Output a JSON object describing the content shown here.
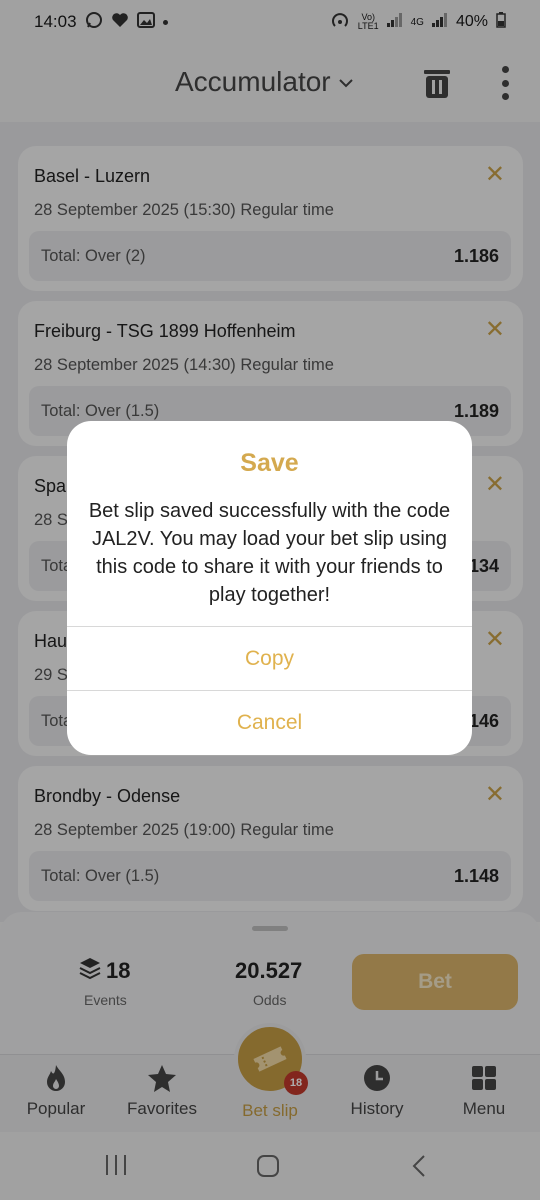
{
  "status": {
    "time": "14:03",
    "battery": "40%",
    "network": "4G"
  },
  "header": {
    "title": "Accumulator"
  },
  "bets": [
    {
      "match": "Basel - Luzern",
      "date": "28 September 2025 (15:30) Regular time",
      "pick": "Total: Over (2)",
      "odd": "1.186"
    },
    {
      "match": "Freiburg - TSG 1899 Hoffenheim",
      "date": "28 September 2025 (14:30) Regular time",
      "pick": "Total: Over (1.5)",
      "odd": "1.189"
    },
    {
      "match": "Spa",
      "date": "28 S",
      "pick": "Tota",
      "odd": "134"
    },
    {
      "match": "Hau",
      "date": "29 S",
      "pick": "Tota",
      "odd": "146"
    },
    {
      "match": "Brondby - Odense",
      "date": "28 September 2025 (19:00) Regular time",
      "pick": "Total: Over (1.5)",
      "odd": "1.148"
    }
  ],
  "summary": {
    "events_count": "18",
    "events_label": "Events",
    "odds_value": "20.527",
    "odds_label": "Odds",
    "bet_label": "Bet"
  },
  "nav": {
    "popular": "Popular",
    "favorites": "Favorites",
    "betslip": "Bet slip",
    "betslip_badge": "18",
    "history": "History",
    "menu": "Menu"
  },
  "dialog": {
    "title": "Save",
    "message": "Bet slip saved successfully with the code JAL2V. You may load your bet slip using this code to share it with your friends to play together!",
    "copy_label": "Copy",
    "cancel_label": "Cancel"
  },
  "colors": {
    "accent": "#d4a94f",
    "badge": "#c0392b"
  }
}
